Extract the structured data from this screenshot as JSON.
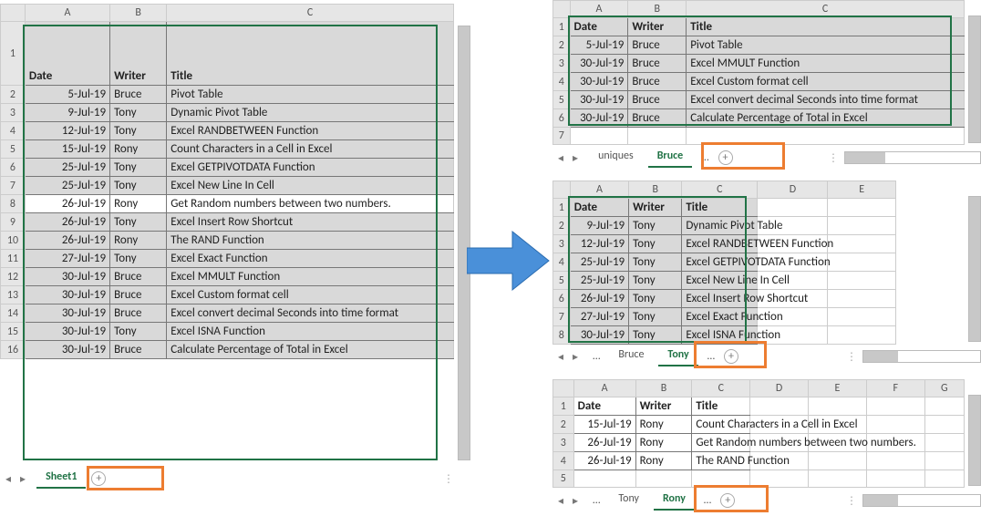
{
  "main": {
    "cols": [
      "A",
      "B",
      "C"
    ],
    "header": {
      "a": "Date",
      "b": "Writer",
      "c": "Title"
    },
    "rows": [
      {
        "n": 2,
        "a": "5-Jul-19",
        "b": "Bruce",
        "c": "Pivot Table"
      },
      {
        "n": 3,
        "a": "9-Jul-19",
        "b": "Tony",
        "c": "Dynamic Pivot Table"
      },
      {
        "n": 4,
        "a": "12-Jul-19",
        "b": "Tony",
        "c": "Excel RANDBETWEEN Function"
      },
      {
        "n": 5,
        "a": "15-Jul-19",
        "b": "Rony",
        "c": "Count Characters in a Cell in Excel"
      },
      {
        "n": 6,
        "a": "25-Jul-19",
        "b": "Tony",
        "c": "Excel GETPIVOTDATA Function"
      },
      {
        "n": 7,
        "a": "25-Jul-19",
        "b": "Tony",
        "c": "Excel New Line In Cell"
      },
      {
        "n": 8,
        "a": "26-Jul-19",
        "b": "Rony",
        "c": "Get Random numbers between two numbers."
      },
      {
        "n": 9,
        "a": "26-Jul-19",
        "b": "Tony",
        "c": "Excel Insert Row Shortcut"
      },
      {
        "n": 10,
        "a": "26-Jul-19",
        "b": "Rony",
        "c": "The RAND Function"
      },
      {
        "n": 11,
        "a": "27-Jul-19",
        "b": "Tony",
        "c": "Excel Exact Function"
      },
      {
        "n": 12,
        "a": "30-Jul-19",
        "b": "Bruce",
        "c": "Excel MMULT Function"
      },
      {
        "n": 13,
        "a": "30-Jul-19",
        "b": "Bruce",
        "c": "Excel Custom format cell"
      },
      {
        "n": 14,
        "a": "30-Jul-19",
        "b": "Bruce",
        "c": "Excel convert decimal Seconds into time format"
      },
      {
        "n": 15,
        "a": "30-Jul-19",
        "b": "Tony",
        "c": "Excel ISNA Function"
      },
      {
        "n": 16,
        "a": "30-Jul-19",
        "b": "Bruce",
        "c": "Calculate Percentage of Total in Excel"
      }
    ],
    "tabs": {
      "active": "Sheet1"
    }
  },
  "bruce": {
    "cols": [
      "A",
      "B",
      "C"
    ],
    "header": {
      "a": "Date",
      "b": "Writer",
      "c": "Title"
    },
    "rows": [
      {
        "n": 2,
        "a": "5-Jul-19",
        "b": "Bruce",
        "c": "Pivot Table"
      },
      {
        "n": 3,
        "a": "30-Jul-19",
        "b": "Bruce",
        "c": "Excel MMULT Function"
      },
      {
        "n": 4,
        "a": "30-Jul-19",
        "b": "Bruce",
        "c": "Excel Custom format cell"
      },
      {
        "n": 5,
        "a": "30-Jul-19",
        "b": "Bruce",
        "c": "Excel convert decimal Seconds into time format"
      },
      {
        "n": 6,
        "a": "30-Jul-19",
        "b": "Bruce",
        "c": "Calculate Percentage of Total in Excel"
      }
    ],
    "tabs": {
      "prev": "uniques",
      "active": "Bruce"
    }
  },
  "tony": {
    "cols": [
      "A",
      "B",
      "C",
      "D",
      "E"
    ],
    "header": {
      "a": "Date",
      "b": "Writer",
      "c": "Title"
    },
    "rows": [
      {
        "n": 2,
        "a": "9-Jul-19",
        "b": "Tony",
        "c": "Dynamic Pivot Table"
      },
      {
        "n": 3,
        "a": "12-Jul-19",
        "b": "Tony",
        "c": "Excel RANDBETWEEN Function"
      },
      {
        "n": 4,
        "a": "25-Jul-19",
        "b": "Tony",
        "c": "Excel GETPIVOTDATA Function"
      },
      {
        "n": 5,
        "a": "25-Jul-19",
        "b": "Tony",
        "c": "Excel New Line In Cell"
      },
      {
        "n": 6,
        "a": "26-Jul-19",
        "b": "Tony",
        "c": "Excel Insert Row Shortcut"
      },
      {
        "n": 7,
        "a": "27-Jul-19",
        "b": "Tony",
        "c": "Excel Exact Function"
      },
      {
        "n": 8,
        "a": "30-Jul-19",
        "b": "Tony",
        "c": "Excel ISNA Function"
      }
    ],
    "tabs": {
      "prev": "Bruce",
      "active": "Tony"
    }
  },
  "rony": {
    "cols": [
      "A",
      "B",
      "C",
      "D",
      "E",
      "F",
      "G"
    ],
    "header": {
      "a": "Date",
      "b": "Writer",
      "c": "Title"
    },
    "rows": [
      {
        "n": 2,
        "a": "15-Jul-19",
        "b": "Rony",
        "c": "Count Characters in a Cell in Excel"
      },
      {
        "n": 3,
        "a": "26-Jul-19",
        "b": "Rony",
        "c": "Get Random numbers between two numbers."
      },
      {
        "n": 4,
        "a": "26-Jul-19",
        "b": "Rony",
        "c": "The RAND Function"
      }
    ],
    "tabs": {
      "prev": "Tony",
      "active": "Rony"
    }
  }
}
